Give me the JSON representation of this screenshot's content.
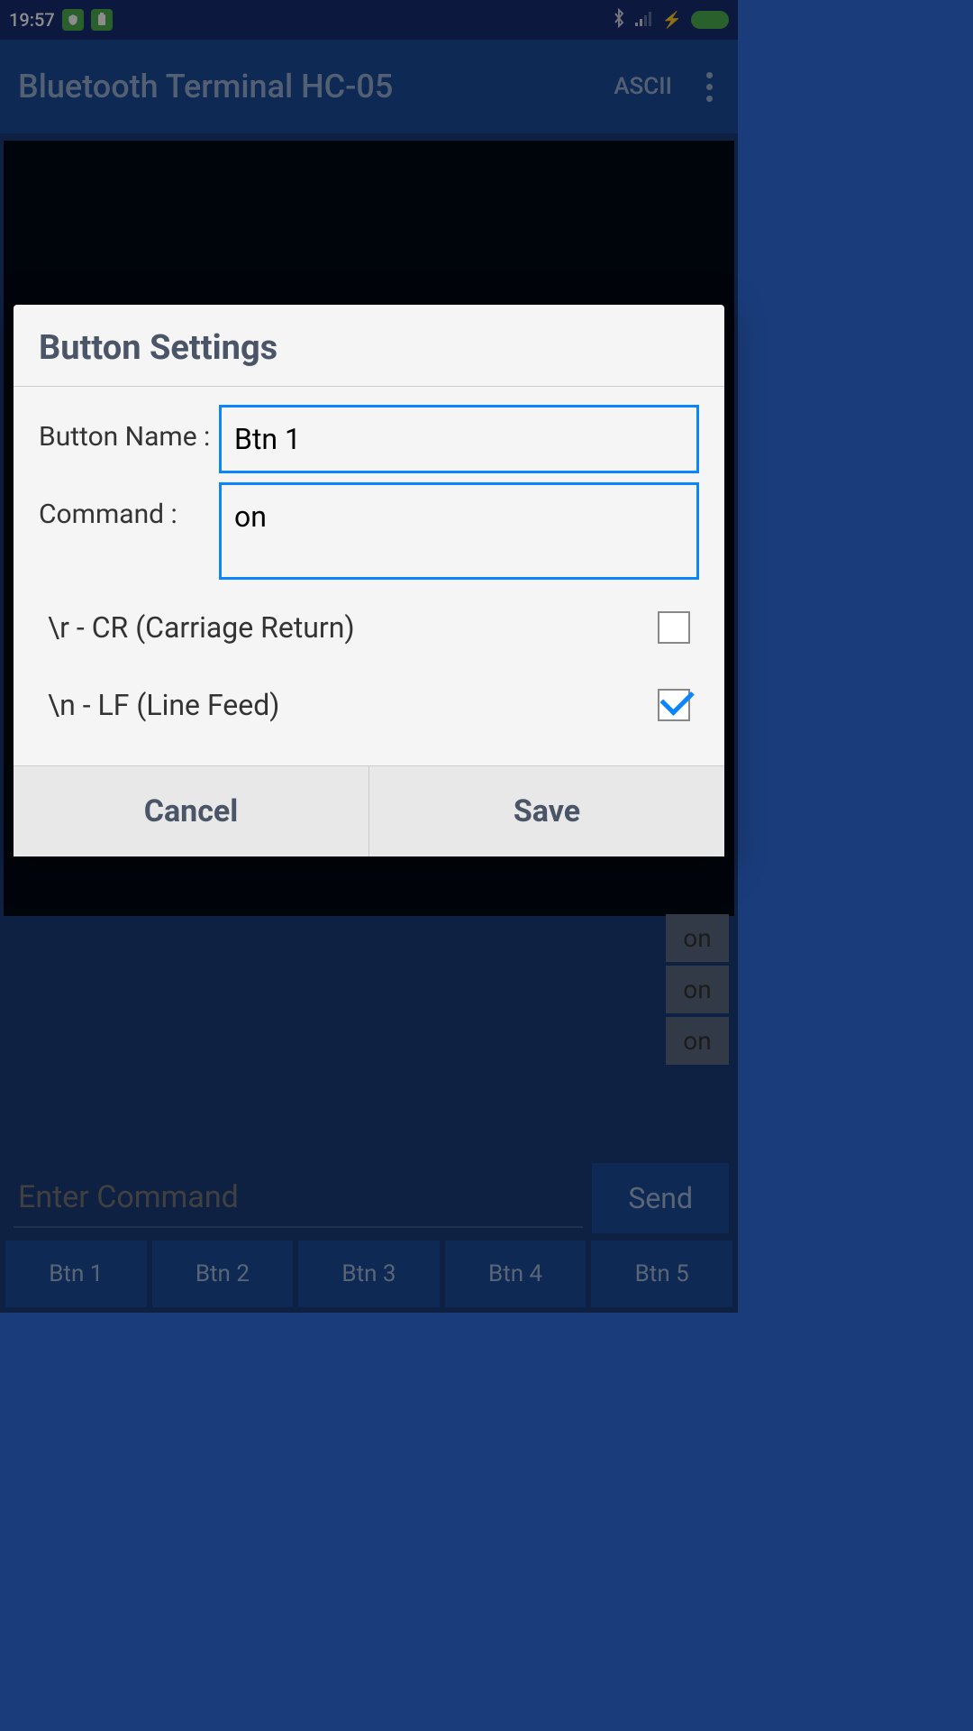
{
  "status_bar": {
    "time": "19:57"
  },
  "app_bar": {
    "title": "Bluetooth Terminal HC-05",
    "mode": "ASCII"
  },
  "history": {
    "items": [
      "on",
      "on",
      "on"
    ]
  },
  "command_input": {
    "placeholder": "Enter Command",
    "send_label": "Send"
  },
  "quick_buttons": [
    "Btn 1",
    "Btn 2",
    "Btn 3",
    "Btn 4",
    "Btn 5"
  ],
  "dialog": {
    "title": "Button Settings",
    "button_name_label": "Button Name :",
    "button_name_value": "Btn 1",
    "command_label": "Command      :",
    "command_value": "on",
    "cr_label": "\\r - CR (Carriage Return)",
    "lf_label": "\\n - LF (Line Feed)",
    "cancel_label": "Cancel",
    "save_label": "Save"
  }
}
